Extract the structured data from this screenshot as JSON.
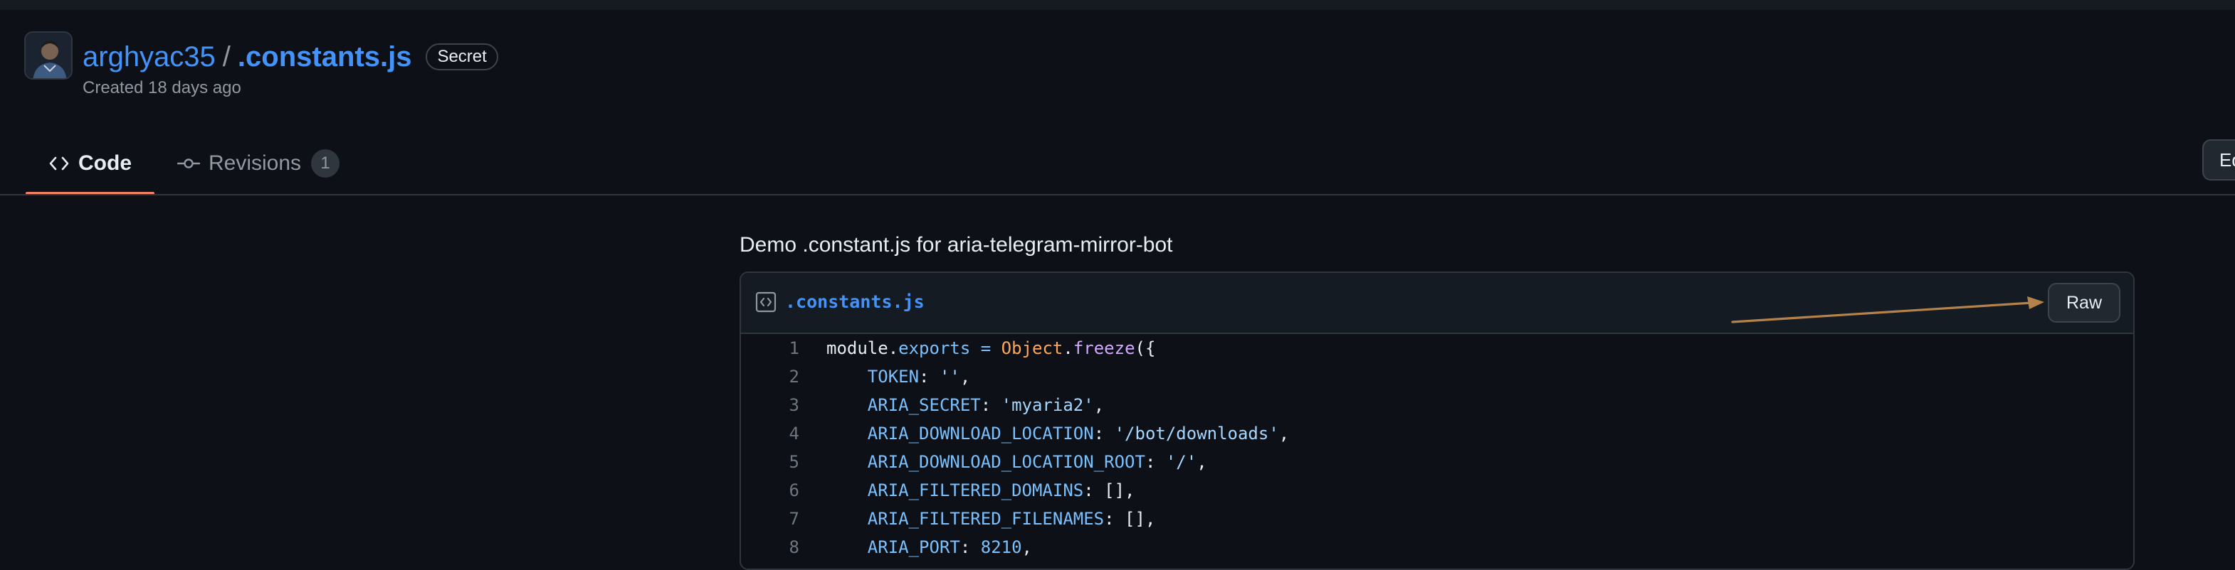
{
  "gist": {
    "owner": "arghyac35",
    "separator": "/",
    "filename": ".constants.js",
    "visibility_badge": "Secret",
    "created": "Created 18 days ago",
    "description": "Demo .constant.js for aria-telegram-mirror-bot"
  },
  "tabs": [
    {
      "label": "Code",
      "icon": "code-icon",
      "selected": true
    },
    {
      "label": "Revisions",
      "icon": "git-commit-icon",
      "count": "1",
      "selected": false
    }
  ],
  "actions": {
    "edit_label": "Edit",
    "raw_label": "Raw"
  },
  "file": {
    "icon": "file-code-icon",
    "name": ".constants.js",
    "lines": [
      {
        "num": "1",
        "tokens": [
          {
            "t": "module.",
            "c": "plain"
          },
          {
            "t": "exports",
            "c": "prop"
          },
          {
            "t": " = ",
            "c": "op"
          },
          {
            "t": "Object",
            "c": "obj"
          },
          {
            "t": ".",
            "c": "plain"
          },
          {
            "t": "freeze",
            "c": "func"
          },
          {
            "t": "({",
            "c": "plain"
          }
        ]
      },
      {
        "num": "2",
        "tokens": [
          {
            "t": "    ",
            "c": "plain"
          },
          {
            "t": "TOKEN",
            "c": "key"
          },
          {
            "t": ": ",
            "c": "plain"
          },
          {
            "t": "''",
            "c": "str"
          },
          {
            "t": ",",
            "c": "plain"
          }
        ]
      },
      {
        "num": "3",
        "tokens": [
          {
            "t": "    ",
            "c": "plain"
          },
          {
            "t": "ARIA_SECRET",
            "c": "key"
          },
          {
            "t": ": ",
            "c": "plain"
          },
          {
            "t": "'myaria2'",
            "c": "str"
          },
          {
            "t": ",",
            "c": "plain"
          }
        ]
      },
      {
        "num": "4",
        "tokens": [
          {
            "t": "    ",
            "c": "plain"
          },
          {
            "t": "ARIA_DOWNLOAD_LOCATION",
            "c": "key"
          },
          {
            "t": ": ",
            "c": "plain"
          },
          {
            "t": "'/bot/downloads'",
            "c": "str"
          },
          {
            "t": ",",
            "c": "plain"
          }
        ]
      },
      {
        "num": "5",
        "tokens": [
          {
            "t": "    ",
            "c": "plain"
          },
          {
            "t": "ARIA_DOWNLOAD_LOCATION_ROOT",
            "c": "key"
          },
          {
            "t": ": ",
            "c": "plain"
          },
          {
            "t": "'/'",
            "c": "str"
          },
          {
            "t": ",",
            "c": "plain"
          }
        ]
      },
      {
        "num": "6",
        "tokens": [
          {
            "t": "    ",
            "c": "plain"
          },
          {
            "t": "ARIA_FILTERED_DOMAINS",
            "c": "key"
          },
          {
            "t": ": [],",
            "c": "plain"
          }
        ]
      },
      {
        "num": "7",
        "tokens": [
          {
            "t": "    ",
            "c": "plain"
          },
          {
            "t": "ARIA_FILTERED_FILENAMES",
            "c": "key"
          },
          {
            "t": ": [],",
            "c": "plain"
          }
        ]
      },
      {
        "num": "8",
        "tokens": [
          {
            "t": "    ",
            "c": "plain"
          },
          {
            "t": "ARIA_PORT",
            "c": "key"
          },
          {
            "t": ": ",
            "c": "plain"
          },
          {
            "t": "8210",
            "c": "prop"
          },
          {
            "t": ",",
            "c": "plain"
          }
        ]
      }
    ]
  },
  "colors": {
    "background": "#0d1117",
    "link": "#4493f8",
    "tab_underline": "#f78166",
    "annotation_arrow": "#b5834a"
  }
}
